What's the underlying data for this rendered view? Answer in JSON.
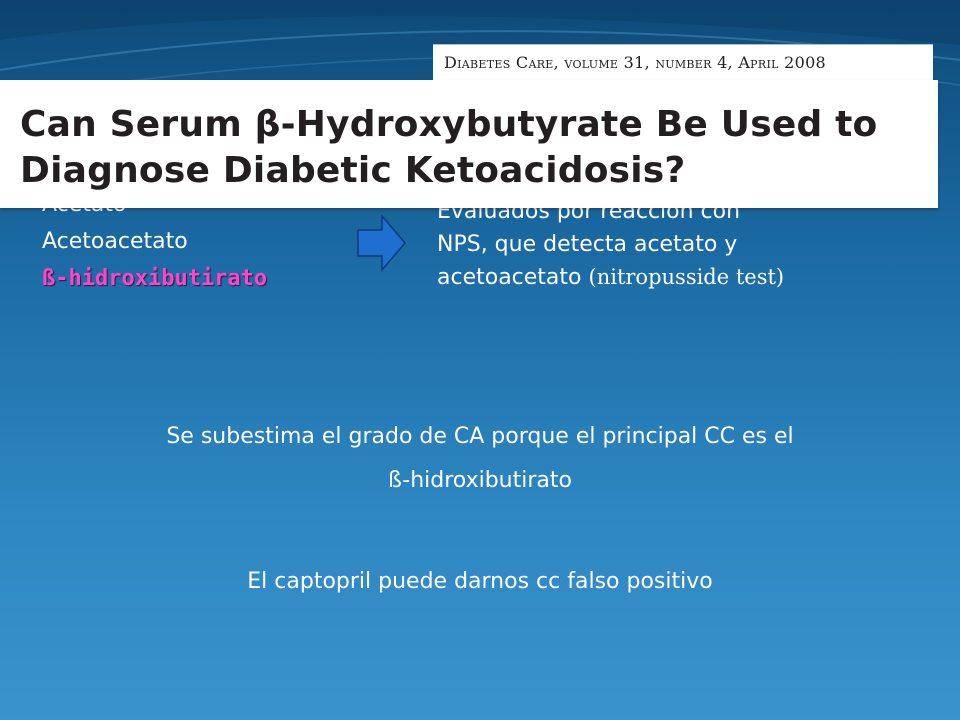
{
  "left_list": {
    "item1": "Acetato",
    "item2": "Acetoacetato",
    "item3": "ß-hidroxibutirato"
  },
  "right": {
    "line1": "Evaluados por reacción con",
    "line2": "NPS, que detecta acetato y",
    "line3_main": "acetoacetato",
    "line3_paren": "(nitropusside test)"
  },
  "journal": "Diabetes Care, volume 31, number 4, April 2008",
  "article_title": {
    "line1": "Can Serum β-Hydroxybutyrate Be Used to",
    "line2": "Diagnose Diabetic Ketoacidosis?"
  },
  "para1": {
    "line1": "Se subestima el grado de CA porque el principal CC es el",
    "line2": "ß-hidroxibutirato"
  },
  "para2": "El captopril puede darnos cc falso positivo",
  "colors": {
    "highlight": "#ff44c8",
    "arrow": "#1f6fd0"
  }
}
